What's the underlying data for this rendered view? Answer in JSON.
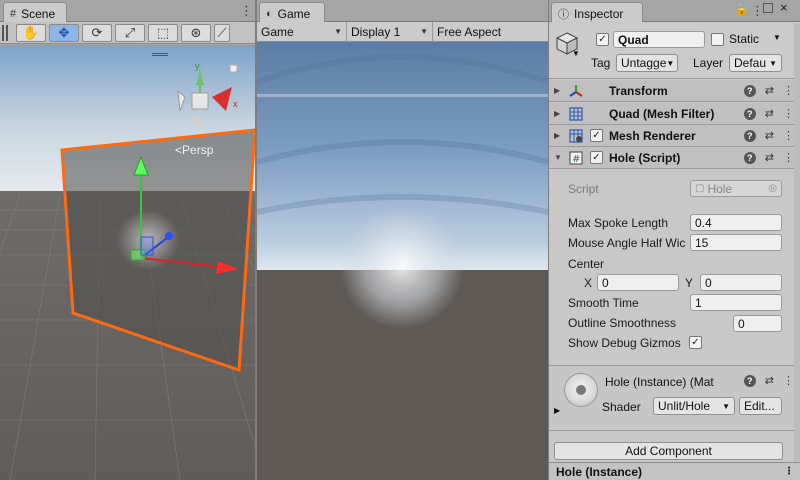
{
  "scene": {
    "tab": "Scene",
    "persp_label": "Persp",
    "gizmo_y": "y",
    "gizmo_x": "x",
    "tools": [
      "hand-tool",
      "move-tool",
      "rotate-tool",
      "scale-tool",
      "rect-tool",
      "transform-tool",
      "custom-tool"
    ]
  },
  "game": {
    "tab": "Game",
    "display_mode": "Game",
    "display": "Display 1",
    "aspect": "Free Aspect"
  },
  "inspector": {
    "tab": "Inspector",
    "object_name": "Quad",
    "static_label": "Static",
    "tag_label": "Tag",
    "tag_value": "Untagge",
    "layer_label": "Layer",
    "layer_value": "Defau",
    "components": [
      {
        "name": "Transform"
      },
      {
        "name": "Quad (Mesh Filter)"
      },
      {
        "name": "Mesh Renderer"
      },
      {
        "name": "Hole (Script)"
      }
    ],
    "script": {
      "script_label": "Script",
      "script_value": "Hole",
      "max_spoke_label": "Max Spoke Length",
      "max_spoke_value": "0.4",
      "mouse_angle_label": "Mouse Angle Half Wic",
      "mouse_angle_value": "15",
      "center_label": "Center",
      "x_label": "X",
      "x_value": "0",
      "y_label": "Y",
      "y_value": "0",
      "smooth_time_label": "Smooth Time",
      "smooth_time_value": "1",
      "outline_label": "Outline Smoothness",
      "outline_value": "0",
      "debug_label": "Show Debug Gizmos"
    },
    "material": {
      "title": "Hole (Instance) (Mat",
      "shader_label": "Shader",
      "shader_value": "Unlit/Hole",
      "edit_label": "Edit..."
    },
    "add_component": "Add Component",
    "footer": "Hole (Instance)"
  }
}
